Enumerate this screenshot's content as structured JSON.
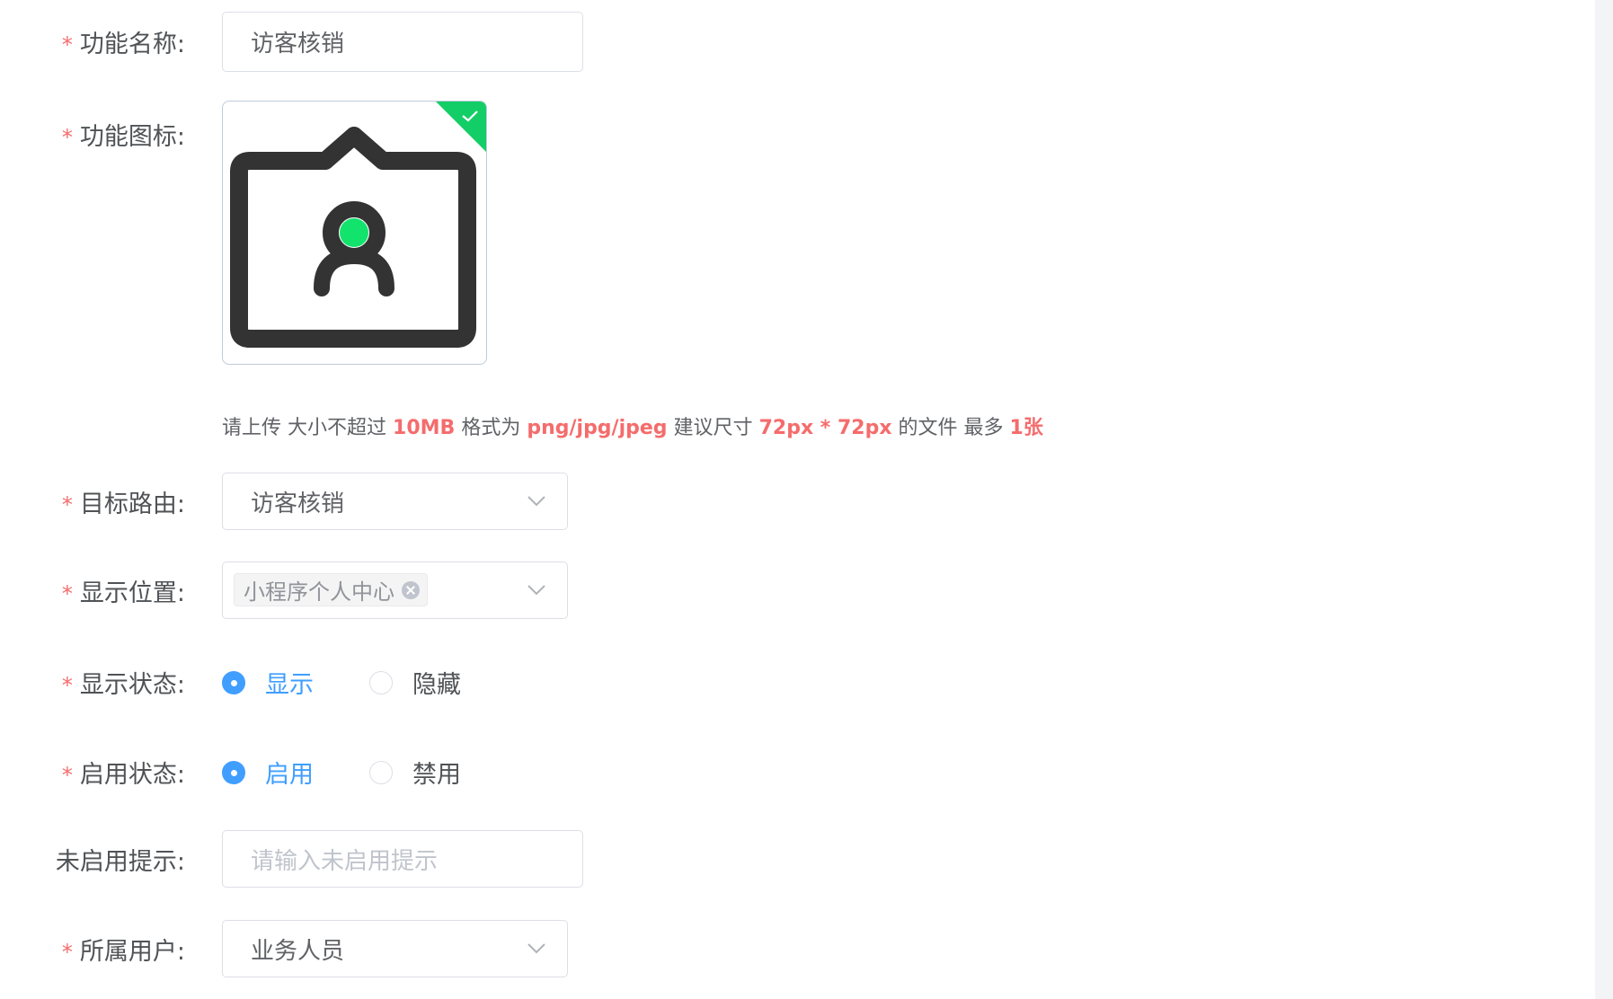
{
  "form": {
    "required_mark": "*",
    "name": {
      "label": "功能名称:",
      "value": "访客核销"
    },
    "icon": {
      "label": "功能图标:",
      "icon_name": "visitor-badge-icon",
      "badge_icon": "check-icon",
      "accent_color": "#13ce66"
    },
    "upload_tip": {
      "prefix": "请上传",
      "size_text": "大小不超过",
      "size_value": "10MB",
      "format_text": "格式为",
      "format_value": "png/jpg/jpeg",
      "dimension_text": "建议尺寸",
      "dimension_value": "72px * 72px",
      "file_text": "的文件",
      "max_text": "最多",
      "max_value": "1张"
    },
    "route": {
      "label": "目标路由:",
      "value": "访客核销"
    },
    "position": {
      "label": "显示位置:",
      "tag": "小程序个人中心"
    },
    "display_status": {
      "label": "显示状态:",
      "options": [
        "显示",
        "隐藏"
      ],
      "selected": "显示"
    },
    "enable_status": {
      "label": "启用状态:",
      "options": [
        "启用",
        "禁用"
      ],
      "selected": "启用"
    },
    "disabled_tip": {
      "label": "未启用提示:",
      "placeholder": "请输入未启用提示"
    },
    "user": {
      "label": "所属用户:",
      "value": "业务人员"
    }
  },
  "colors": {
    "primary": "#409eff",
    "danger": "#f56c6c",
    "border": "#dcdfe6",
    "text": "#606266"
  }
}
